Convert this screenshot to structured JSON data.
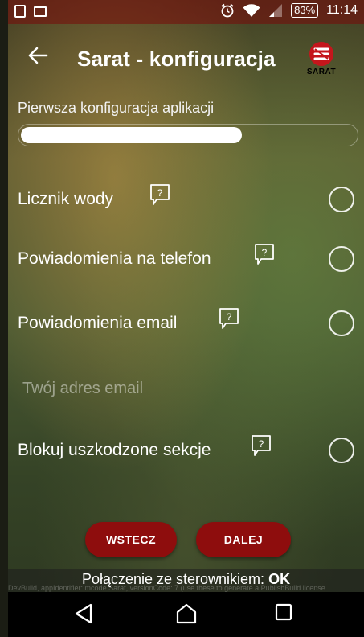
{
  "status_bar": {
    "battery": "83%",
    "time": "11:14"
  },
  "app_bar": {
    "title": "Sarat - konfiguracja",
    "logo_text": "SARAT"
  },
  "progress": {
    "label": "Pierwsza konfiguracja aplikacji",
    "value": 0.66
  },
  "options": [
    {
      "label": "Licznik wody",
      "checked": false
    },
    {
      "label": "Powiadomienia na telefon",
      "checked": false
    },
    {
      "label": "Powiadomienia email",
      "checked": false
    },
    {
      "label": "Blokuj uszkodzone sekcje",
      "checked": false
    }
  ],
  "email": {
    "placeholder": "Twój adres email",
    "value": ""
  },
  "buttons": {
    "back": "WSTECZ",
    "next": "DALEJ"
  },
  "footer": {
    "connection_label": "Połączenie ze sterownikiem:",
    "connection_status": "OK",
    "dev_text": "DevBuild, appIdentifier: mcode.Sarat, versionCode: 7 (use these to generate a PublishBuild license"
  },
  "colors": {
    "accent": "#8e0d0d",
    "status_bar": "#7a1010"
  }
}
